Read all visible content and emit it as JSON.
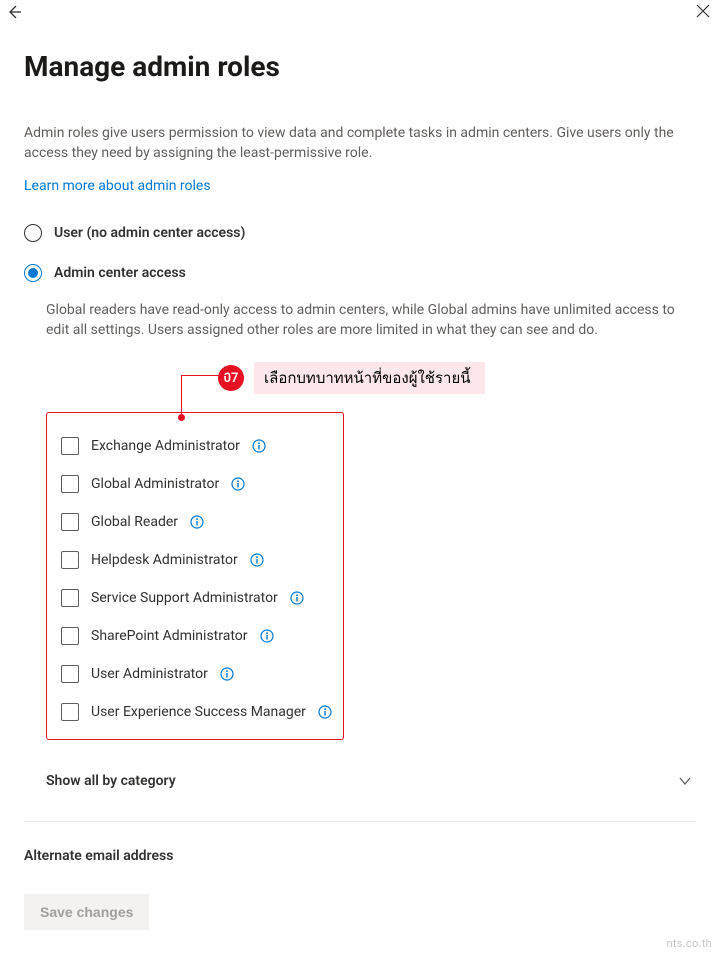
{
  "title": "Manage admin roles",
  "description": "Admin roles give users permission to view data and complete tasks in admin centers. Give users only the access they need by assigning the least-permissive role.",
  "learn_more": "Learn more about admin roles",
  "radios": {
    "no_access": "User (no admin center access)",
    "access": "Admin center access",
    "selected": "access"
  },
  "access_desc": "Global readers have read-only access to admin centers, while Global admins have unlimited access to edit all settings. Users assigned other roles are more limited in what they can see and do.",
  "callout": {
    "step": "07",
    "text": "เลือกบทบาทหน้าที่ของผู้ใช้รายนี้"
  },
  "roles": [
    {
      "label": "Exchange Administrator"
    },
    {
      "label": "Global Administrator"
    },
    {
      "label": "Global Reader"
    },
    {
      "label": "Helpdesk Administrator"
    },
    {
      "label": "Service Support Administrator"
    },
    {
      "label": "SharePoint Administrator"
    },
    {
      "label": "User Administrator"
    },
    {
      "label": "User Experience Success Manager"
    }
  ],
  "expander_label": "Show all by category",
  "alt_email_label": "Alternate email address",
  "save_button": "Save changes",
  "watermark": "nts.co.th"
}
